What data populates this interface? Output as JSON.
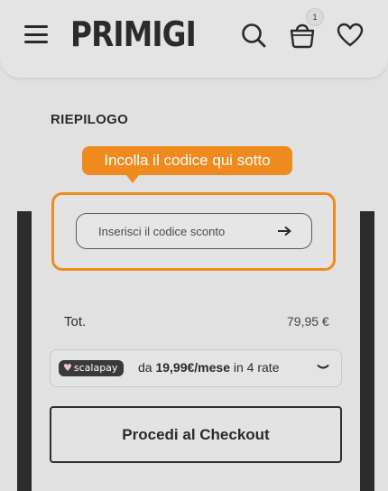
{
  "header": {
    "logo": "PRIMIGI",
    "cart_count": "1",
    "icons": [
      "menu-icon",
      "search-icon",
      "shopping-bag-icon",
      "heart-icon"
    ]
  },
  "summary": {
    "title": "RIEPILOGO",
    "tooltip": "Incolla il codice qui sotto",
    "coupon": {
      "placeholder": "Inserisci il codice sconto",
      "value": "",
      "submit_icon": "arrow-right-icon"
    },
    "total_label": "Tot.",
    "total_value": "79,95 €",
    "scalapay": {
      "brand": "scalapay",
      "prefix": "da ",
      "amount": "19,99€/mese",
      "suffix": " in 4 rate"
    },
    "checkout_label": "Procedi al Checkout"
  },
  "colors": {
    "accent": "#ef8a1f",
    "background": "#e1e1e1",
    "dark": "#2c2c2c"
  }
}
